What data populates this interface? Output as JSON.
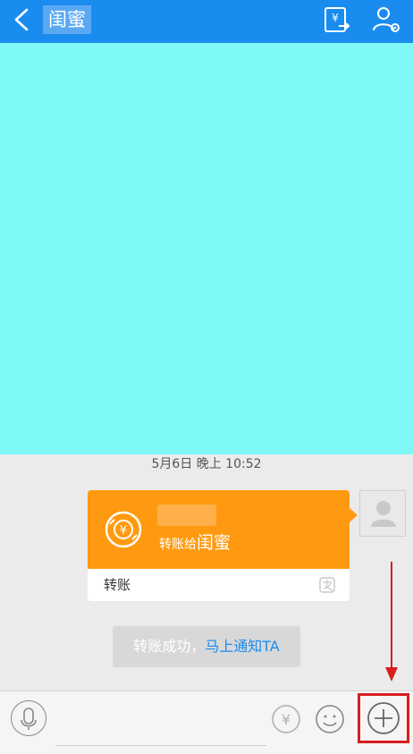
{
  "header": {
    "title": "闺蜜"
  },
  "chat": {
    "timestamp": "5月6日 晚上 10:52",
    "transfer_card": {
      "to_prefix": "转账给",
      "to_name": "闺蜜",
      "label": "转账"
    },
    "notice": {
      "text": "转账成功，",
      "link": "马上通知TA"
    }
  },
  "icons": {
    "back": "chevron-left-icon",
    "transfer": "transfer-icon",
    "profile_settings": "user-settings-icon",
    "mic": "microphone-icon",
    "yen": "yen-icon",
    "emoji": "emoji-icon",
    "plus": "plus-icon"
  },
  "colors": {
    "top_bar": "#1a8cf0",
    "cyan_area": "#7ff8f8",
    "transfer_orange": "#ff9a10",
    "annotation_red": "#d81e1e"
  }
}
